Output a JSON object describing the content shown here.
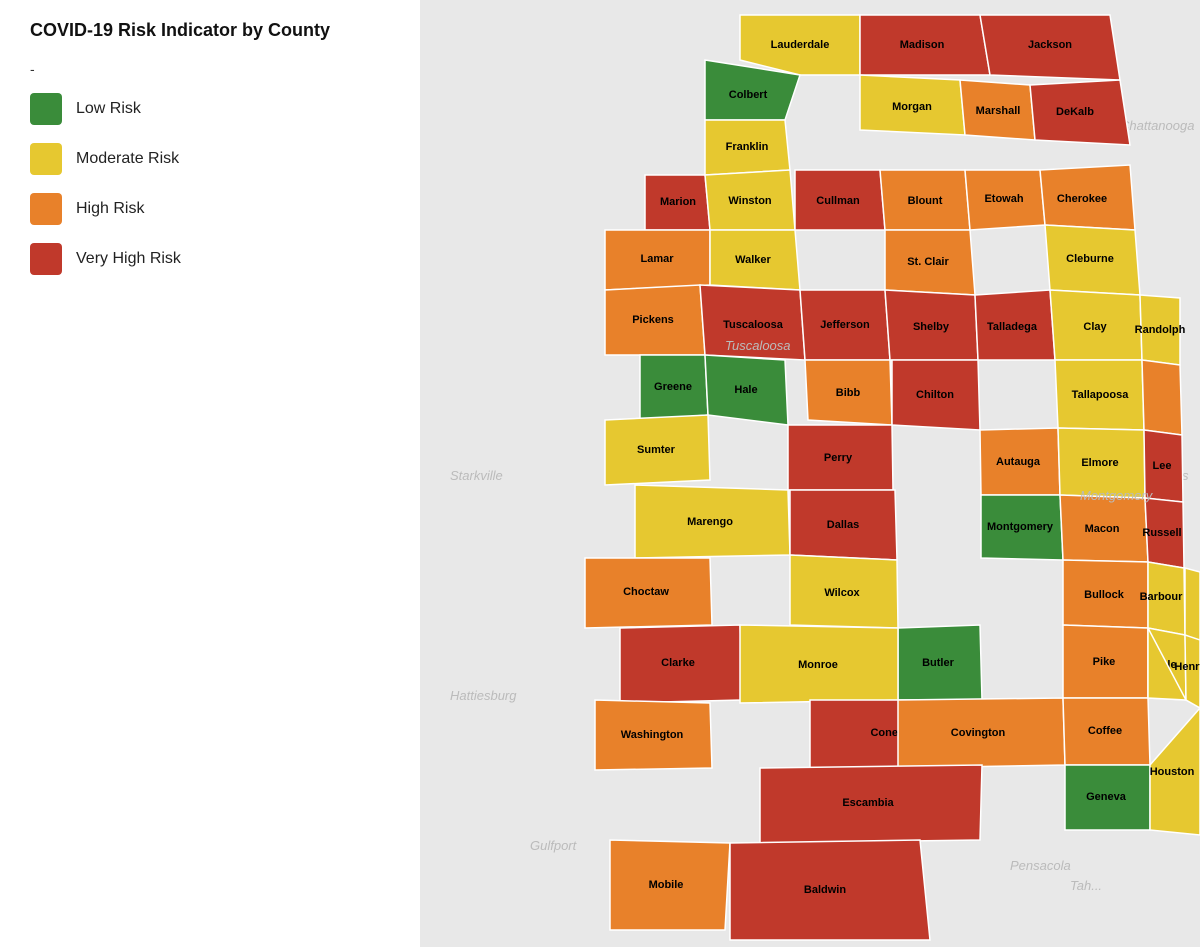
{
  "title": "COVID-19 Risk Indicator by County",
  "legend": {
    "dash": "-",
    "items": [
      {
        "label": "Low Risk",
        "color": "#3a8c3a",
        "id": "low"
      },
      {
        "label": "Moderate Risk",
        "color": "#e6c830",
        "id": "moderate"
      },
      {
        "label": "High Risk",
        "color": "#e8812a",
        "id": "high"
      },
      {
        "label": "Very High Risk",
        "color": "#c0392b",
        "id": "very-high"
      }
    ]
  },
  "colors": {
    "low": "#3a8c3a",
    "moderate": "#e6c830",
    "high": "#e8812a",
    "very_high": "#c0392b"
  }
}
